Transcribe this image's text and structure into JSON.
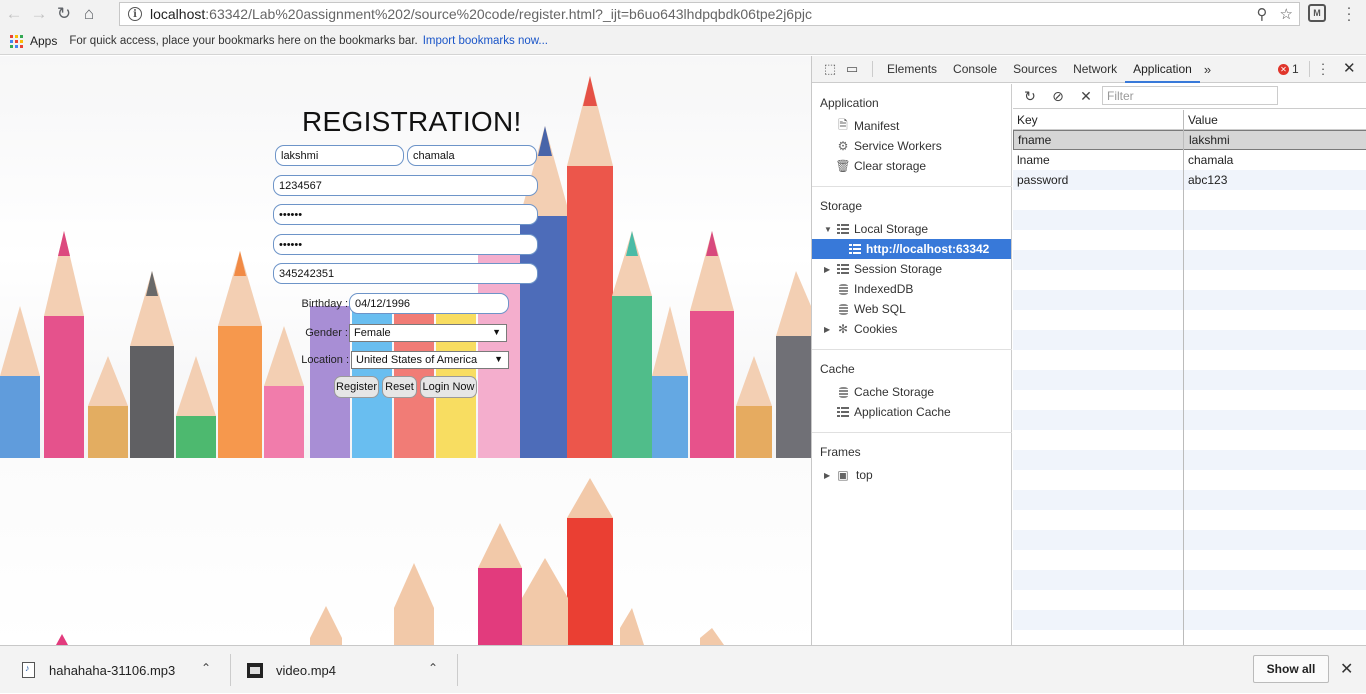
{
  "browser": {
    "url_host": "localhost",
    "url_rest": ":63342/Lab%20assignment%202/source%20code/register.html?_ijt=b6uo643lhdpqbdk06tpe2j6pjc",
    "ext_label": "M"
  },
  "bookmarks": {
    "apps_label": "Apps",
    "hint": "For quick access, place your bookmarks here on the bookmarks bar.",
    "import_link": "Import bookmarks now..."
  },
  "form": {
    "title": "REGISTRATION!",
    "first_name": "lakshmi",
    "last_name": "chamala",
    "phone": "1234567",
    "password": "••••••",
    "confirm_password": "••••••",
    "number": "345242351",
    "birthday_label": "Birthday :",
    "birthday_value": "04/12/1996",
    "gender_label": "Gender :",
    "gender_value": "Female",
    "location_label": "Location :",
    "location_value": "United States of America",
    "register_btn": "Register",
    "reset_btn": "Reset",
    "login_btn": "Login Now"
  },
  "devtools": {
    "tabs": [
      "Elements",
      "Console",
      "Sources",
      "Network",
      "Application"
    ],
    "active_tab": "Application",
    "error_count": "1",
    "sections": {
      "application": "Application",
      "storage": "Storage",
      "cache": "Cache",
      "frames": "Frames"
    },
    "app_items": [
      "Manifest",
      "Service Workers",
      "Clear storage"
    ],
    "storage_items": {
      "local_storage": "Local Storage",
      "local_origin": "http://localhost:63342",
      "session_storage": "Session Storage",
      "indexeddb": "IndexedDB",
      "websql": "Web SQL",
      "cookies": "Cookies"
    },
    "cache_items": [
      "Cache Storage",
      "Application Cache"
    ],
    "frames_items": [
      "top"
    ],
    "filter_placeholder": "Filter",
    "table": {
      "key_header": "Key",
      "value_header": "Value",
      "rows": [
        {
          "key": "fname",
          "value": "lakshmi"
        },
        {
          "key": "lname",
          "value": "chamala"
        },
        {
          "key": "password",
          "value": "abc123"
        }
      ]
    }
  },
  "downloads": {
    "items": [
      "hahahaha-31106.mp3",
      "video.mp4"
    ],
    "show_all": "Show all"
  }
}
